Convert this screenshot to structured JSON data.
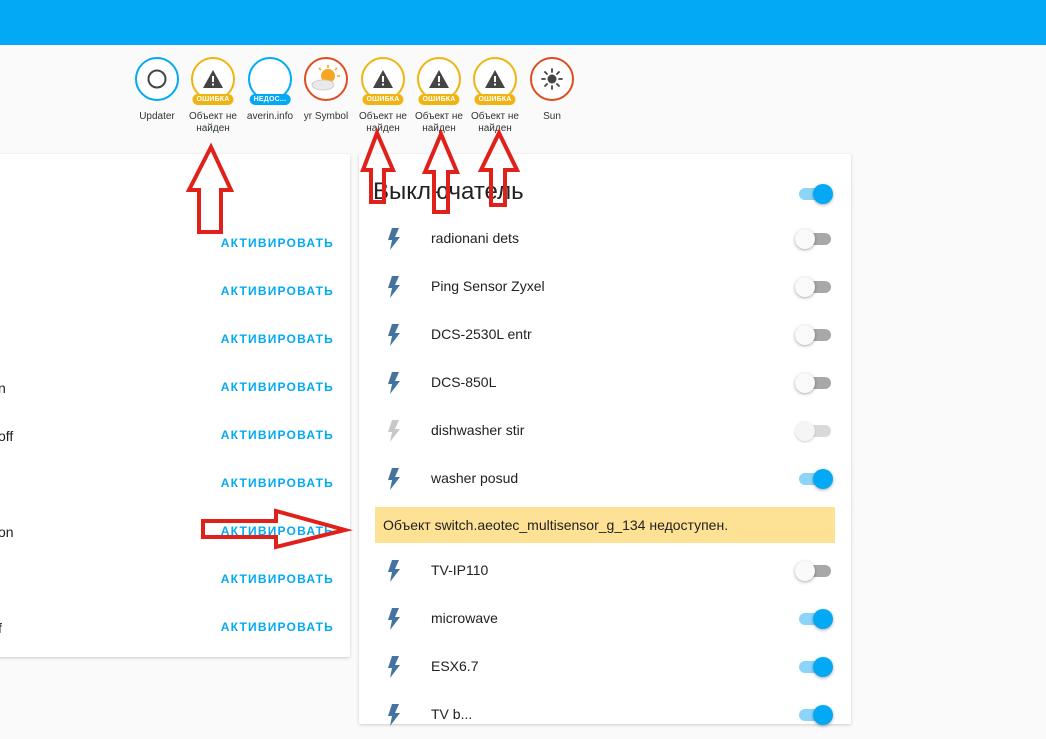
{
  "colors": {
    "primary": "#03a9f4",
    "error": "#f0b412",
    "warning_bg": "#fde194",
    "annotation": "#e0201a"
  },
  "badges": [
    {
      "name": "Updater",
      "icon": "circle-icon",
      "pill": ""
    },
    {
      "name": "Объект не найден",
      "icon": "warning-icon",
      "pill": "ОШИБКА"
    },
    {
      "name": "averin.info",
      "icon": "",
      "pill": "НЕДОС..."
    },
    {
      "name": "yr Symbol",
      "icon": "weather-sun-cloud-icon",
      "pill": ""
    },
    {
      "name": "Объект не найден",
      "icon": "warning-icon",
      "pill": "ОШИБКА"
    },
    {
      "name": "Объект не найден",
      "icon": "warning-icon",
      "pill": "ОШИБКА"
    },
    {
      "name": "Объект не найден",
      "icon": "warning-icon",
      "pill": "ОШИБКА"
    },
    {
      "name": "Sun",
      "icon": "sun-icon",
      "pill": ""
    }
  ],
  "scenes": {
    "action_label": "АКТИВИРОВАТЬ",
    "rows": [
      {
        "fragment": ""
      },
      {
        "fragment": ""
      },
      {
        "fragment": ""
      },
      {
        "fragment": "n"
      },
      {
        "fragment": "off"
      },
      {
        "fragment": ""
      },
      {
        "fragment": "on"
      },
      {
        "fragment": ""
      },
      {
        "fragment": "f"
      }
    ]
  },
  "switches": {
    "title": "Выключатель",
    "master_on": true,
    "items": [
      {
        "name": "radionani dets",
        "state": "off"
      },
      {
        "name": "Ping Sensor Zyxel",
        "state": "off"
      },
      {
        "name": "DCS-2530L entr",
        "state": "off"
      },
      {
        "name": "DCS-850L",
        "state": "off"
      },
      {
        "name": "dishwasher stir",
        "state": "disabled"
      },
      {
        "name": "washer posud",
        "state": "on"
      },
      {
        "name": "TV-IP110",
        "state": "off"
      },
      {
        "name": "microwave",
        "state": "on"
      },
      {
        "name": "ESX6.7",
        "state": "on"
      },
      {
        "name": "TV b...",
        "state": "on"
      }
    ],
    "unavailable_message": "Объект switch.aeotec_multisensor_g_134 недоступен."
  }
}
